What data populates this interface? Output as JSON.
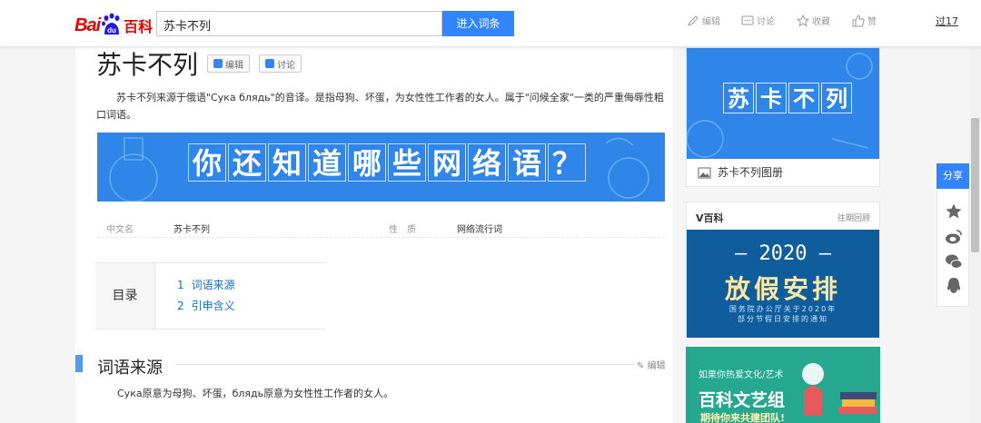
{
  "header": {
    "logo": {
      "bai": "Bai",
      "du": "du",
      "ke": "百科"
    },
    "search_value": "苏卡不列",
    "search_button": "进入词条",
    "tools": {
      "edit": "编辑",
      "discuss": "讨论",
      "favorite": "收藏",
      "like": "赞"
    },
    "user": "过17"
  },
  "entry": {
    "title": "苏卡不列",
    "edit_btn": "编辑",
    "discuss_btn": "讨论",
    "summary": "苏卡不列来源于俄语\"Сука блядь\"的音译。是指母狗、坏蛋，为女性性工作者的女人。属于\"问候全家\"一类的严重侮辱性粗口词语。",
    "banner_chars": [
      "你",
      "还",
      "知",
      "道",
      "哪",
      "些",
      "网",
      "络",
      "语",
      "？"
    ],
    "info": {
      "k1": "中文名",
      "v1": "苏卡不列",
      "k2": "性　质",
      "v2": "网络流行词"
    },
    "toc": {
      "label": "目录",
      "items": [
        {
          "num": "1",
          "text": "词语来源"
        },
        {
          "num": "2",
          "text": "引申含义"
        }
      ]
    },
    "section1": {
      "title": "词语来源",
      "edit": "编辑",
      "body": "Сука原意为母狗、坏蛋，блядь原意为女性性工作者的女人。"
    }
  },
  "sidebar": {
    "album": {
      "chars": [
        "苏",
        "卡",
        "不",
        "列"
      ],
      "caption": "苏卡不列图册"
    },
    "v": {
      "head": "V百科",
      "more": "往期回顾",
      "year": "— 2020 —",
      "main": "放假安排",
      "sub1": "国务院办公厅关于2020年",
      "sub2": "部分节假日安排的通知"
    },
    "art": {
      "line1": "如果你热爱文化/艺术",
      "line2": "百科文艺组",
      "line3": "期待你来共建团队!"
    }
  },
  "share": {
    "label": "分享"
  },
  "colors": {
    "accent": "#3385ff",
    "banner": "#2f86e8",
    "link": "#136ec2",
    "brand": "#e10602"
  }
}
